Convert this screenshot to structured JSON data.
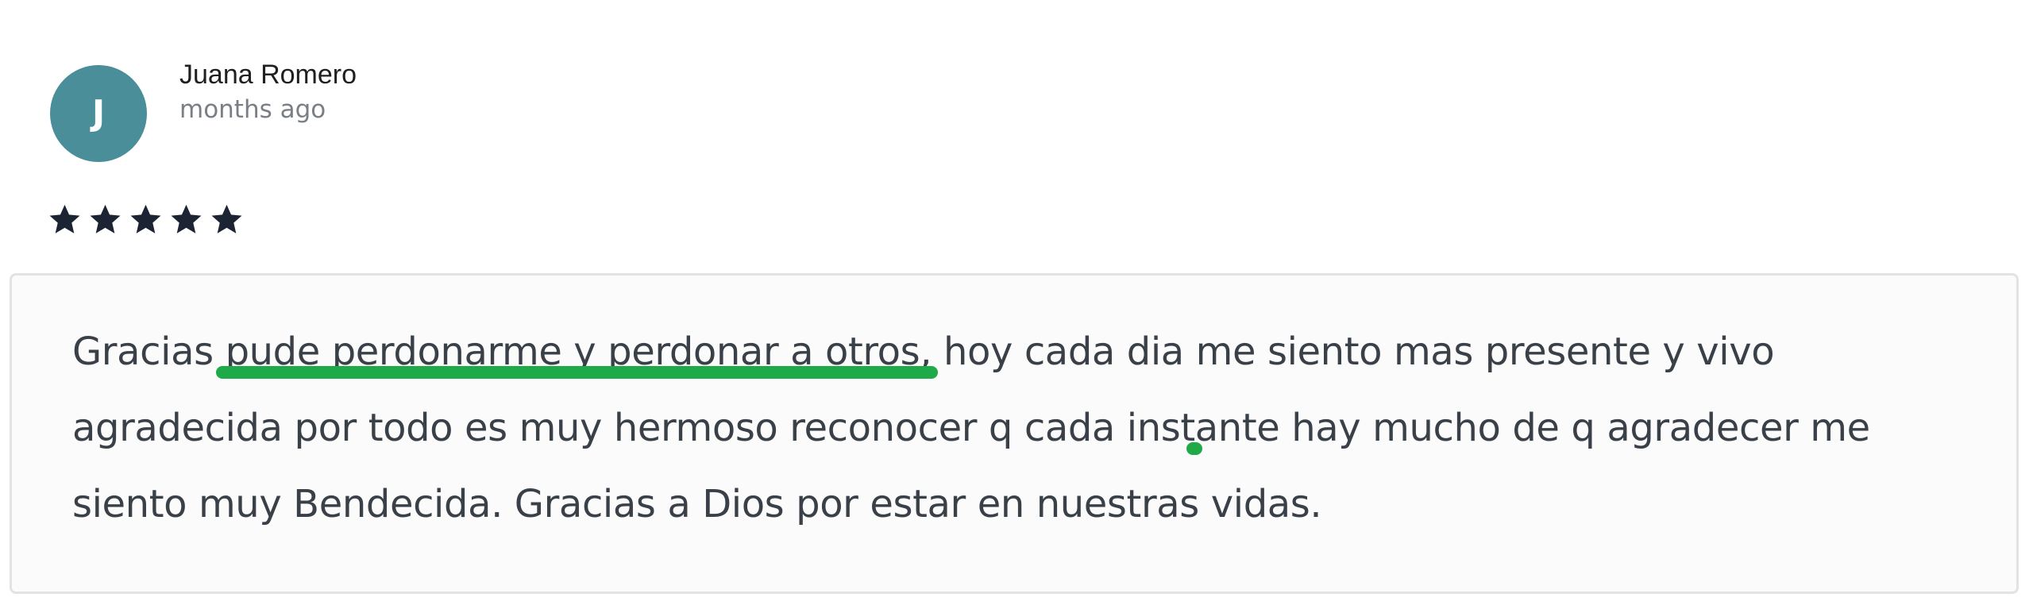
{
  "review": {
    "author": {
      "initial": "J",
      "name": "Juana Romero",
      "time": "months ago",
      "avatar_color": "#4a8e9a"
    },
    "rating": {
      "value": 5,
      "max": 5,
      "star_color": "#1c2333"
    },
    "body": {
      "segments": [
        {
          "text": "Gracias ",
          "highlight": false
        },
        {
          "text": "pude perdonarme y perdonar a otros,",
          "highlight": true
        },
        {
          "text": " hoy cada dia ",
          "highlight": false
        },
        {
          "text": "me siento mas presente y vivo agradecida por todo",
          "highlight": true
        },
        {
          "text": " es muy hermoso reconocer q cada instante hay mucho de q agradecer me siento muy Bendecida. Gracias a Dios por estar en nuestras vidas.",
          "highlight": false
        }
      ],
      "highlight_color": "#1faa4a"
    }
  }
}
